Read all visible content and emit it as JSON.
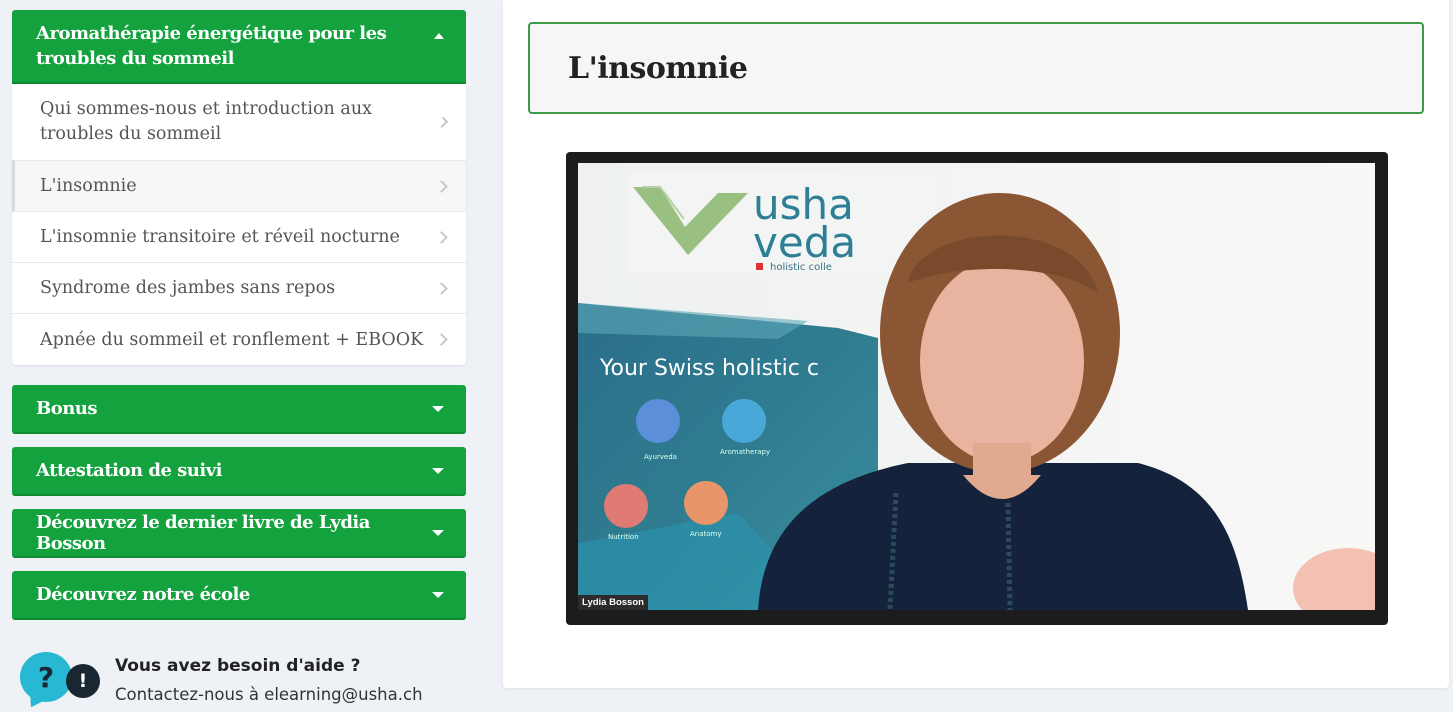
{
  "sidebar": {
    "open_section": {
      "title": "Aromathérapie énergétique pour les troubles du sommeil",
      "lessons": [
        {
          "label": "Qui sommes-nous et introduction aux troubles du sommeil"
        },
        {
          "label": "L'insomnie"
        },
        {
          "label": "L'insomnie transitoire et réveil nocturne"
        },
        {
          "label": "Syndrome des jambes sans repos"
        },
        {
          "label": "Apnée du sommeil et ronflement + EBOOK"
        }
      ]
    },
    "sections": [
      {
        "title": "Bonus"
      },
      {
        "title": "Attestation de suivi"
      },
      {
        "title": "Découvrez le dernier livre de Lydia Bosson"
      },
      {
        "title": "Découvrez notre école"
      }
    ]
  },
  "help": {
    "title": "Vous avez besoin d'aide ?",
    "contact": "Contactez-nous à elearning@usha.ch",
    "icon_q": "?",
    "icon_e": "!"
  },
  "main": {
    "lesson_title": "L'insomnie",
    "video": {
      "logo_line1": "usha",
      "logo_line2": "veda",
      "logo_tagline": "holistic colle",
      "banner_text": "Your Swiss holistic c",
      "icons": [
        {
          "label": "Ayurveda",
          "color": "#5b8fd9"
        },
        {
          "label": "Aromatherapy",
          "color": "#4aa8d8"
        },
        {
          "label": "Nutrition",
          "color": "#e07b74"
        },
        {
          "label": "Anatomy",
          "color": "#e8956a"
        }
      ],
      "speaker": "Lydia Bosson"
    }
  },
  "colors": {
    "accent": "#14a23f",
    "title_border": "#3d9b47"
  }
}
